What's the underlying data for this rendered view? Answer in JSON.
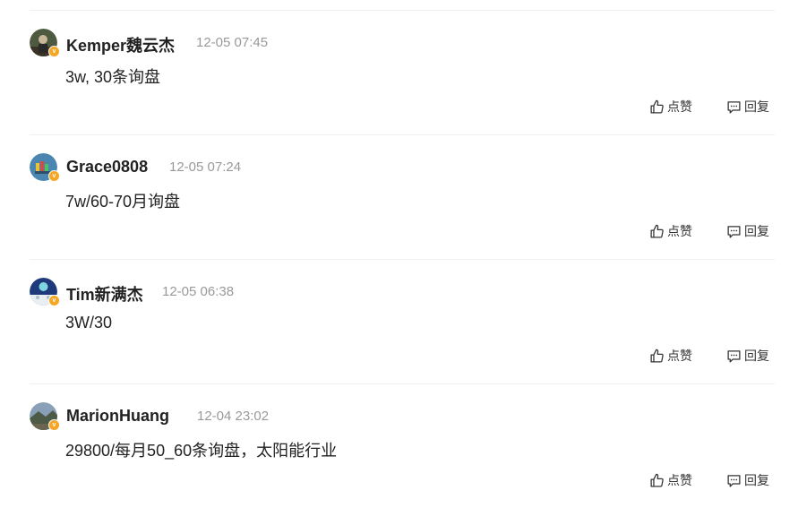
{
  "comments": [
    {
      "username": "Kemper魏云杰",
      "time": "12-05 07:45",
      "content": "3w, 30条询盘",
      "like_label": "点赞",
      "reply_label": "回复",
      "avatar_color": "#5b6b4a",
      "verified_badge": "v"
    },
    {
      "username": "Grace0808",
      "time": "12-05 07:24",
      "content": "7w/60-70月询盘",
      "like_label": "点赞",
      "reply_label": "回复",
      "avatar_color": "#4a7fa8",
      "verified_badge": "v"
    },
    {
      "username": "Tim新满杰",
      "time": "12-05 06:38",
      "content": "3W/30",
      "like_label": "点赞",
      "reply_label": "回复",
      "avatar_color": "#2a4a8a",
      "verified_badge": "v"
    },
    {
      "username": "MarionHuang",
      "time": "12-04 23:02",
      "content": "29800/每月50_60条询盘，太阳能行业",
      "like_label": "点赞",
      "reply_label": "回复",
      "avatar_color": "#6a7a8a",
      "verified_badge": "v"
    }
  ]
}
